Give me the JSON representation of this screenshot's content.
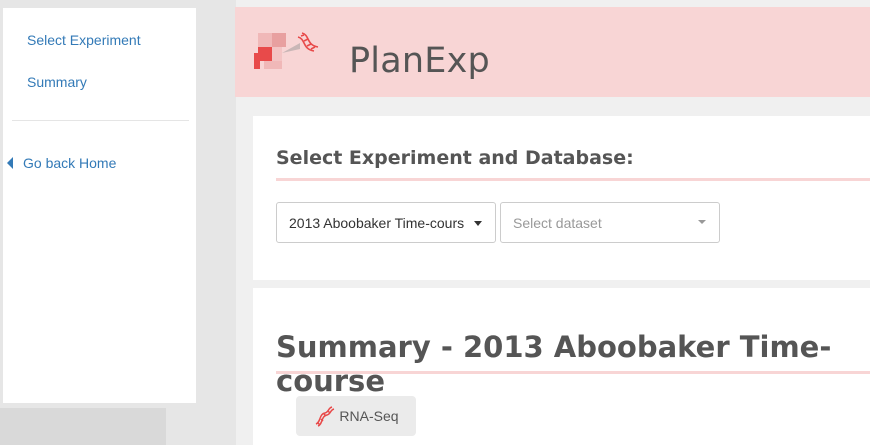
{
  "sidebar": {
    "items": [
      {
        "label": "Select Experiment"
      },
      {
        "label": "Summary"
      }
    ],
    "back_label": "Go back Home"
  },
  "header": {
    "title": "PlanExp"
  },
  "select_panel": {
    "title": "Select Experiment and Database:",
    "experiment_value": "2013 Aboobaker Time-cours",
    "dataset_placeholder": "Select dataset"
  },
  "summary_panel": {
    "title": "Summary - 2013 Aboobaker Time-course",
    "badge_label": "RNA-Seq"
  },
  "colors": {
    "header_bg": "#f8d5d5",
    "accent_red": "#e84a4a",
    "link": "#337ab7"
  }
}
